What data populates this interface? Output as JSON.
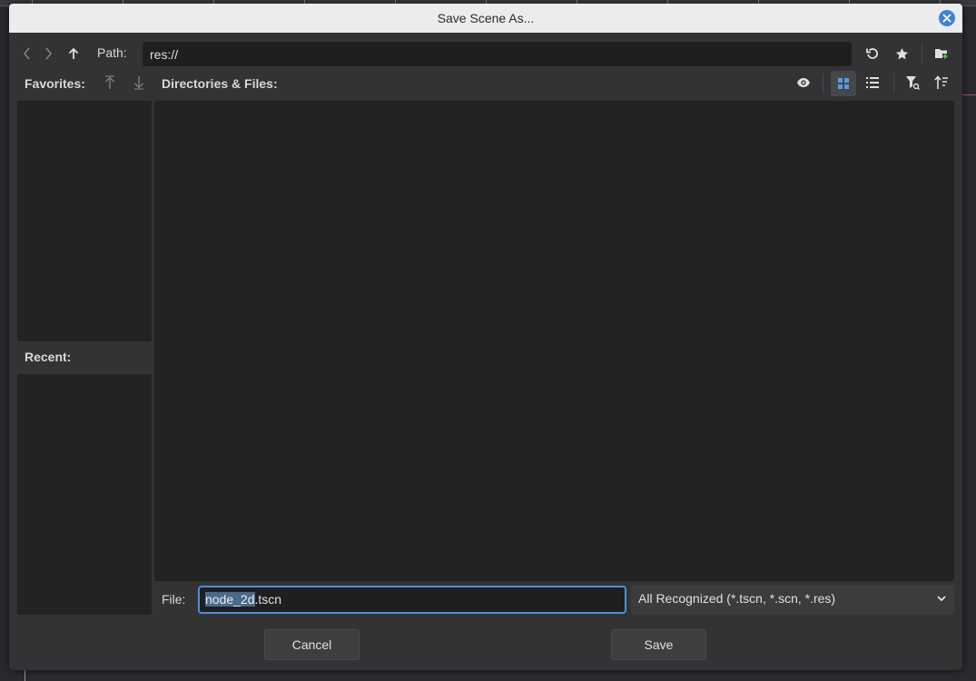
{
  "dialog": {
    "title": "Save Scene As...",
    "close_icon": "close-icon"
  },
  "toolbar": {
    "back_icon": "chevron-left-icon",
    "forward_icon": "chevron-right-icon",
    "up_icon": "arrow-up-icon",
    "path_label": "Path:",
    "path_value": "res://",
    "refresh_icon": "refresh-icon",
    "favorite_icon": "star-icon",
    "new_folder_icon": "new-folder-icon"
  },
  "sidebar": {
    "favorites_label": "Favorites:",
    "move_up_icon": "move-up-icon",
    "move_down_icon": "move-down-icon",
    "recent_label": "Recent:"
  },
  "files": {
    "header_label": "Directories & Files:",
    "show_hidden_icon": "eye-icon",
    "grid_view_icon": "grid-view-icon",
    "list_view_icon": "list-view-icon",
    "filter_icon": "filter-icon",
    "sort_icon": "sort-icon"
  },
  "footer": {
    "file_label": "File:",
    "file_name_selected": "node_2d",
    "file_name_ext": ".tscn",
    "filter_value": "All Recognized (*.tscn, *.scn, *.res)",
    "cancel_label": "Cancel",
    "save_label": "Save"
  },
  "colors": {
    "accent": "#4e8fd6",
    "dialog_bg": "#333335",
    "panel_bg": "#232323"
  }
}
